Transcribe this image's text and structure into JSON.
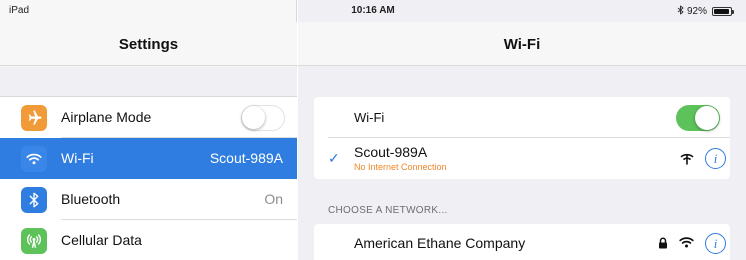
{
  "status_bar": {
    "device": "iPad",
    "time": "10:16 AM",
    "battery_text": "92%",
    "battery_level": 0.92,
    "bluetooth_icon": "bluetooth-icon"
  },
  "left_pane": {
    "title": "Settings",
    "items": [
      {
        "label": "Airplane Mode",
        "value": "",
        "icon": "airplane-icon",
        "icon_color": "#f19a38",
        "toggle": "off"
      },
      {
        "label": "Wi-Fi",
        "value": "Scout-989A",
        "icon": "wifi-icon",
        "icon_color": "#3a86e8",
        "selected": true
      },
      {
        "label": "Bluetooth",
        "value": "On",
        "icon": "bluetooth-icon",
        "icon_color": "#2f7de1"
      },
      {
        "label": "Cellular Data",
        "value": "",
        "icon": "cellular-icon",
        "icon_color": "#5ec25a"
      }
    ]
  },
  "right_pane": {
    "title": "Wi-Fi",
    "wifi_toggle_label": "Wi-Fi",
    "wifi_toggle_state": "on",
    "connected_network": {
      "name": "Scout-989A",
      "status": "No Internet Connection",
      "icons": [
        "checkmark-icon",
        "no-internet-icon",
        "info-icon"
      ]
    },
    "section_header": "CHOOSE A NETWORK...",
    "networks": [
      {
        "name": "American Ethane Company",
        "icons": [
          "lock-icon",
          "wifi-icon",
          "info-icon"
        ]
      }
    ]
  },
  "colors": {
    "accent": "#2f7de1",
    "toggle_on": "#5ec25a",
    "warning": "#f0882a",
    "background": "#efeff4"
  }
}
